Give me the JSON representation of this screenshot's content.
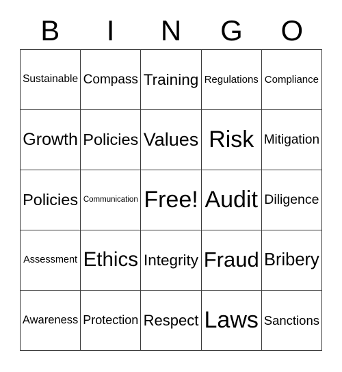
{
  "card": {
    "type": "bingo-card",
    "columns": 5,
    "rows": 5,
    "background_color": "#ffffff",
    "text_color": "#000000",
    "border_color": "#3a3a3a"
  },
  "header": {
    "letters": [
      "B",
      "I",
      "N",
      "G",
      "O"
    ]
  },
  "grid": {
    "rows": [
      {
        "cells": [
          {
            "label": "Sustainable"
          },
          {
            "label": "Compass"
          },
          {
            "label": "Training"
          },
          {
            "label": "Regulations"
          },
          {
            "label": "Compliance"
          }
        ]
      },
      {
        "cells": [
          {
            "label": "Growth"
          },
          {
            "label": "Policies"
          },
          {
            "label": "Values"
          },
          {
            "label": "Risk"
          },
          {
            "label": "Mitigation"
          }
        ]
      },
      {
        "cells": [
          {
            "label": "Policies"
          },
          {
            "label": "Communication"
          },
          {
            "label": "Free!"
          },
          {
            "label": "Audit"
          },
          {
            "label": "Diligence"
          }
        ]
      },
      {
        "cells": [
          {
            "label": "Assessment"
          },
          {
            "label": "Ethics"
          },
          {
            "label": "Integrity"
          },
          {
            "label": "Fraud"
          },
          {
            "label": "Bribery"
          }
        ]
      },
      {
        "cells": [
          {
            "label": "Awareness"
          },
          {
            "label": "Protection"
          },
          {
            "label": "Respect"
          },
          {
            "label": "Laws"
          },
          {
            "label": "Sanctions"
          }
        ]
      }
    ]
  }
}
